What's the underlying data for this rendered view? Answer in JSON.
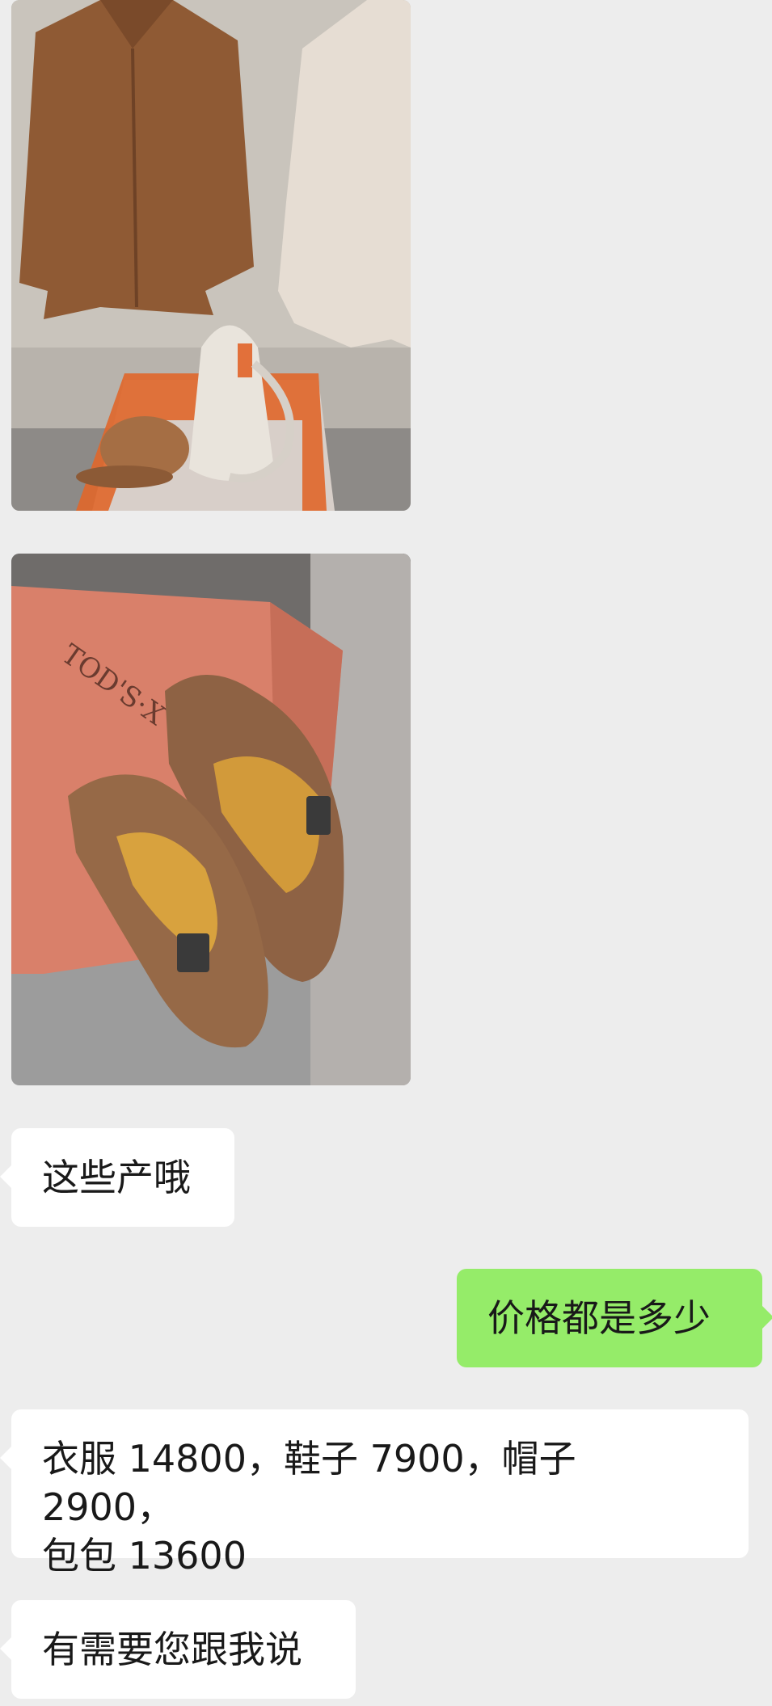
{
  "chat": {
    "images": [
      {
        "subject": "brown jacket, white bag, brown cap on orange stand"
      },
      {
        "subject": "brown suede loafers on orange shoe box",
        "box_text": "TOD'S·X"
      }
    ],
    "messages": [
      {
        "side": "incoming",
        "text": "这些产哦"
      },
      {
        "side": "outgoing",
        "text": "价格都是多少"
      },
      {
        "side": "incoming",
        "line1": "衣服 14800，鞋子 7900，帽子 2900，",
        "line2": "包包 13600"
      },
      {
        "side": "incoming",
        "text": "有需要您跟我说"
      }
    ]
  },
  "colors": {
    "background": "#ededed",
    "incoming_bubble": "#ffffff",
    "outgoing_bubble": "#95ec69"
  }
}
